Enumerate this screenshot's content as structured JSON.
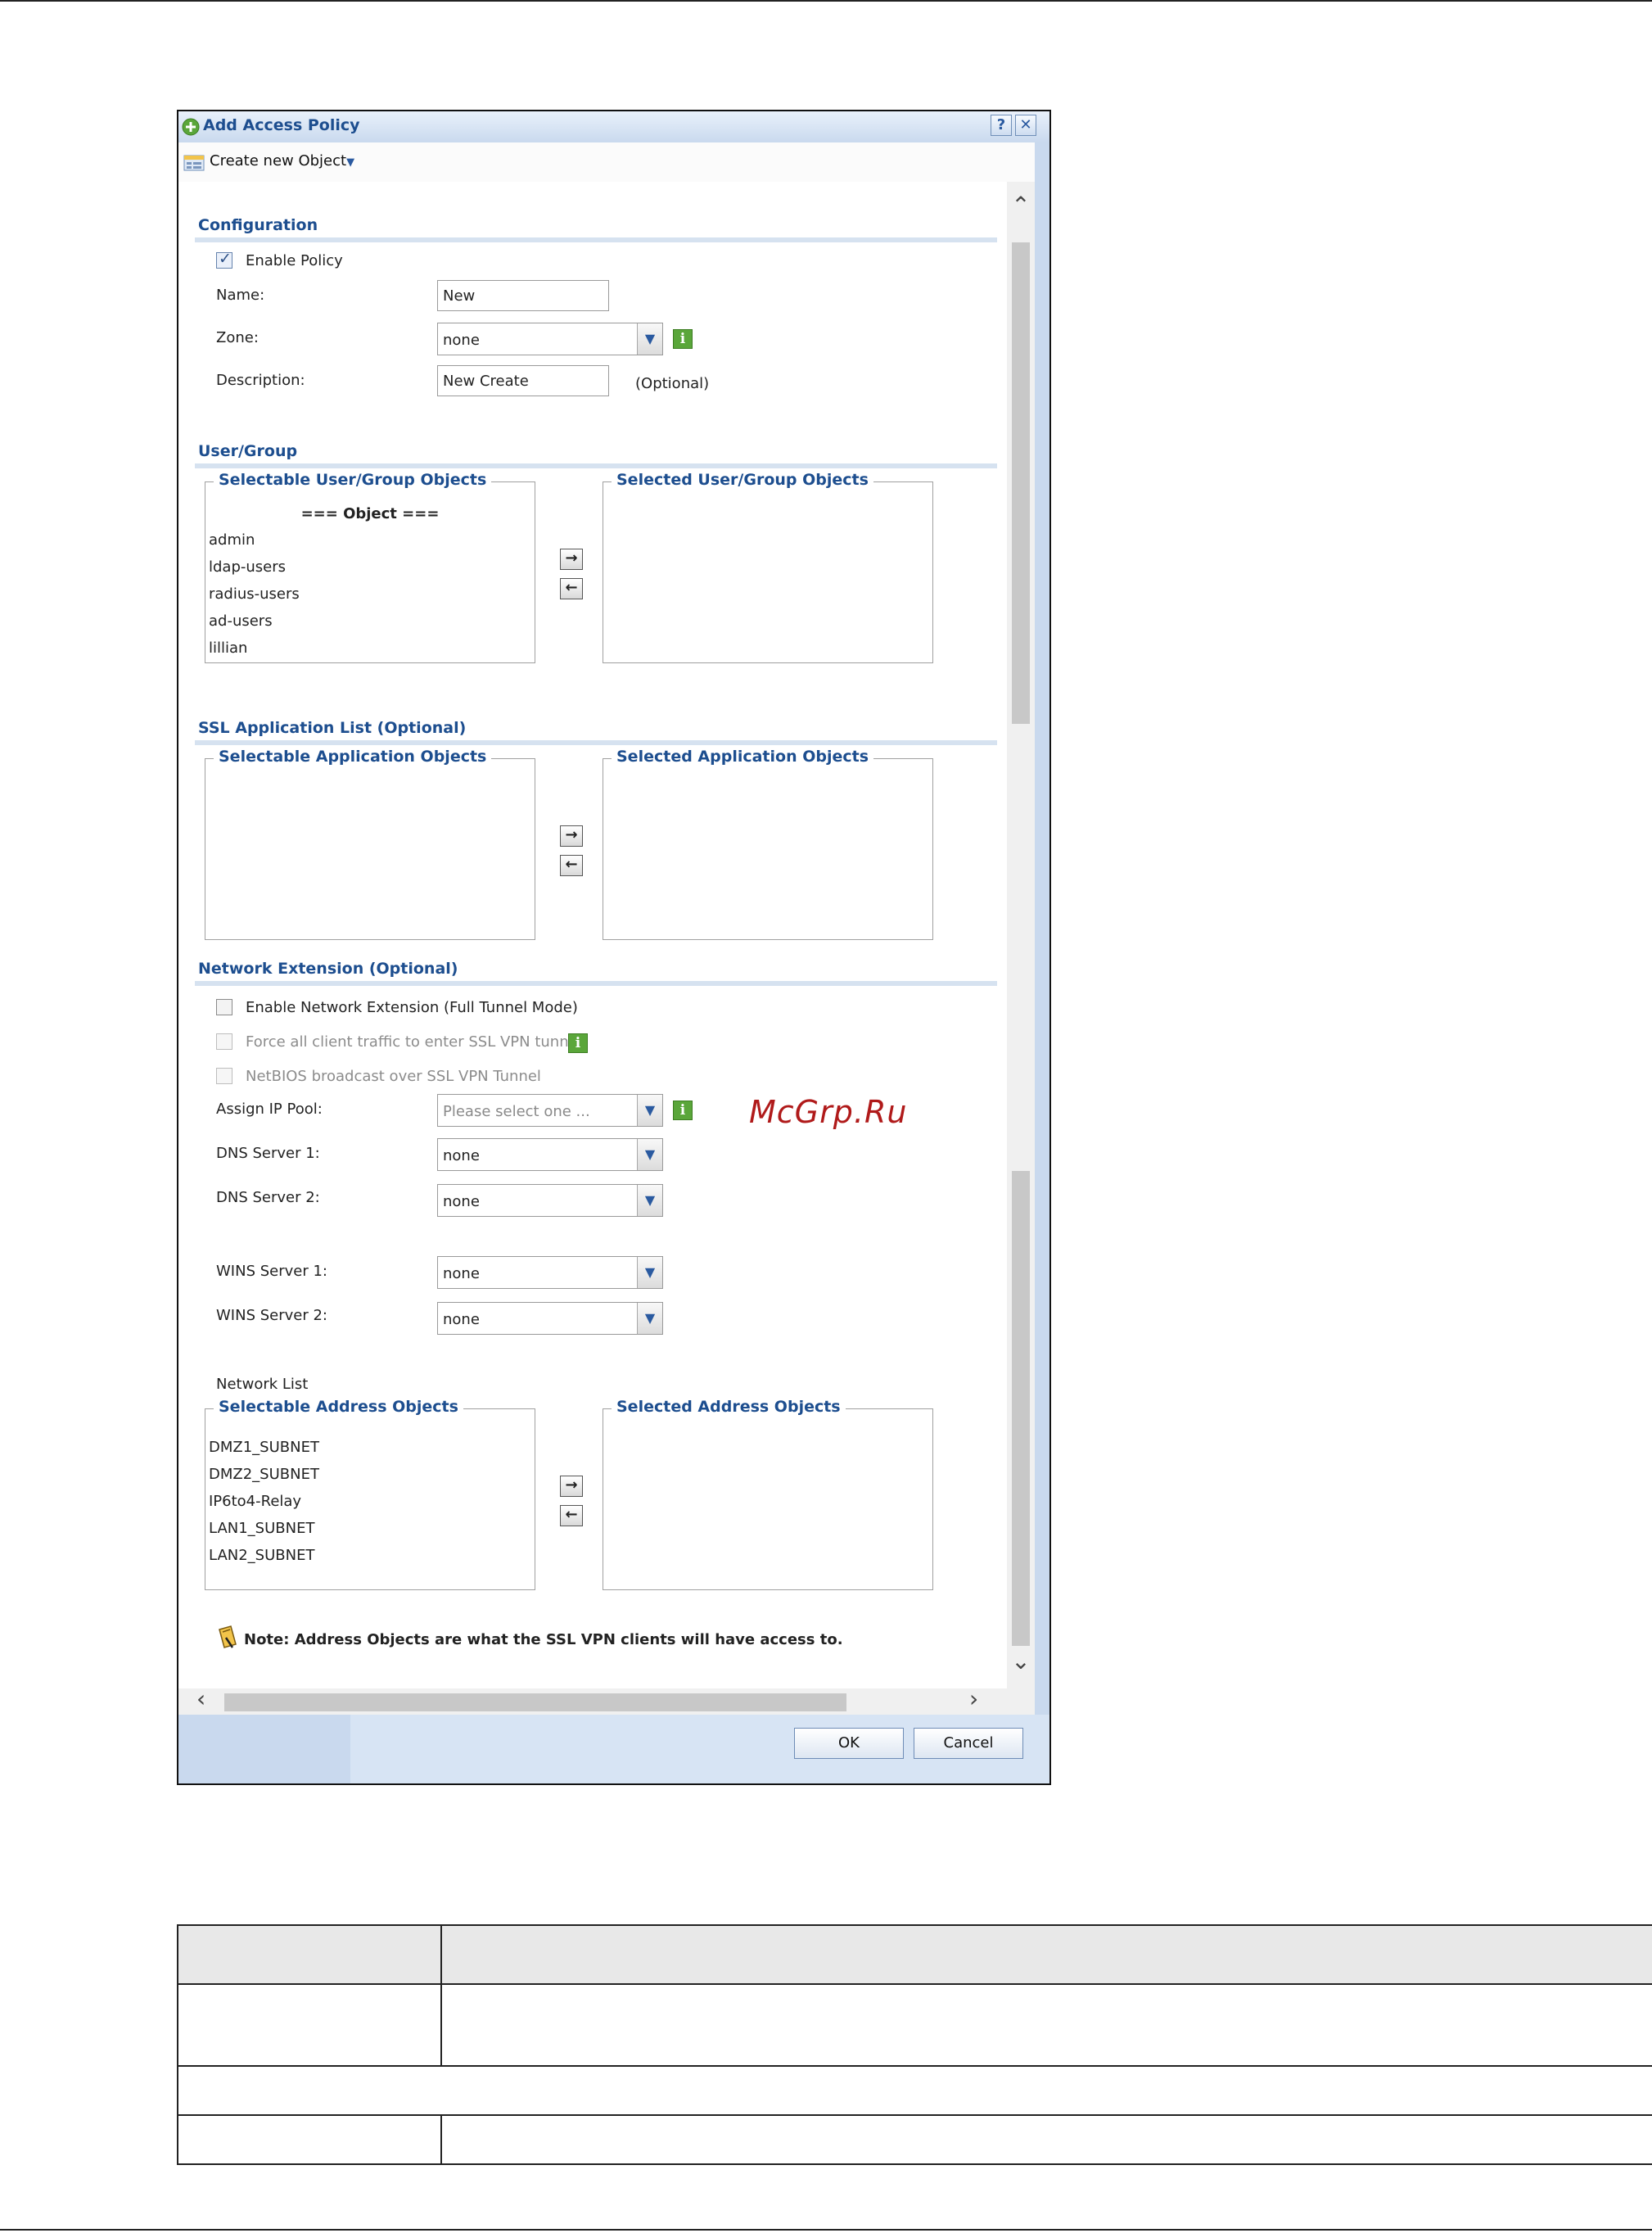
{
  "dialog": {
    "title": "Add Access Policy",
    "help_icon": "question-icon",
    "close_icon": "close-icon",
    "toolbar": {
      "create_label": "Create new Object"
    }
  },
  "configuration": {
    "title": "Configuration",
    "enable_policy": {
      "label": "Enable Policy",
      "checked": true
    },
    "name": {
      "label": "Name:",
      "value": "New"
    },
    "zone": {
      "label": "Zone:",
      "value": "none"
    },
    "description": {
      "label": "Description:",
      "value": "New Create",
      "hint": "(Optional)"
    }
  },
  "user_group": {
    "title": "User/Group",
    "selectable_title": "Selectable User/Group Objects",
    "selected_title": "Selected User/Group Objects",
    "header_item": "=== Object ===",
    "items": [
      "admin",
      "ldap-users",
      "radius-users",
      "ad-users",
      "lillian"
    ]
  },
  "ssl_app": {
    "title": "SSL Application List (Optional)",
    "selectable_title": "Selectable Application Objects",
    "selected_title": "Selected Application Objects"
  },
  "network_ext": {
    "title": "Network Extension (Optional)",
    "enable_label": "Enable Network Extension (Full Tunnel Mode)",
    "force_label": "Force all client traffic to enter SSL VPN tunnel",
    "netbios_label": "NetBIOS broadcast over SSL VPN Tunnel",
    "ip_pool": {
      "label": "Assign IP Pool:",
      "placeholder": "Please select one ..."
    },
    "dns1": {
      "label": "DNS Server 1:",
      "value": "none"
    },
    "dns2": {
      "label": "DNS Server 2:",
      "value": "none"
    },
    "wins1": {
      "label": "WINS Server 1:",
      "value": "none"
    },
    "wins2": {
      "label": "WINS Server 2:",
      "value": "none"
    },
    "network_list_label": "Network List",
    "selectable_title": "Selectable Address Objects",
    "selected_title": "Selected Address Objects",
    "items": [
      "DMZ1_SUBNET",
      "DMZ2_SUBNET",
      "IP6to4-Relay",
      "LAN1_SUBNET",
      "LAN2_SUBNET"
    ],
    "note": "Note: Address Objects are what the SSL VPN clients will have access to."
  },
  "buttons": {
    "ok": "OK",
    "cancel": "Cancel"
  },
  "watermark": "McGrp.Ru"
}
